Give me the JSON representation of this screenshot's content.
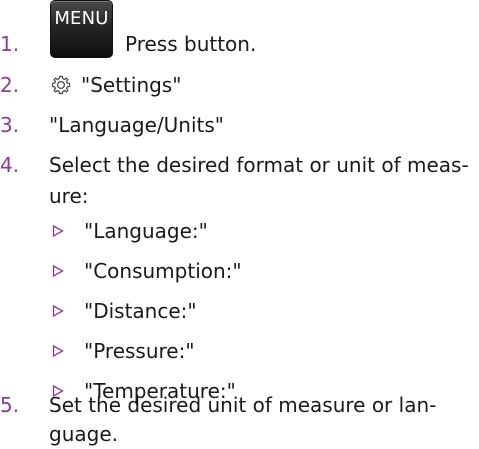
{
  "steps": [
    {
      "number": "1.",
      "button": "MENU",
      "text": "Press button."
    },
    {
      "number": "2.",
      "icon": "gear-icon",
      "text": "\"Settings\""
    },
    {
      "number": "3.",
      "text": "\"Language/Units\""
    },
    {
      "number": "4.",
      "text_line1": "Select the desired format or unit of meas-",
      "text_line2": "ure:"
    },
    {
      "number": "5.",
      "text_line1": "Set the desired unit of measure or lan-",
      "text_line2": "guage."
    }
  ],
  "options": [
    "\"Language:\"",
    "\"Consumption:\"",
    "\"Distance:\"",
    "\"Pressure:\"",
    "\"Temperature:\""
  ],
  "colors": {
    "step_number": "#8a3d92",
    "bullet": "#8a3d92",
    "text": "#1a1a1a",
    "button_bg": "#262626"
  }
}
